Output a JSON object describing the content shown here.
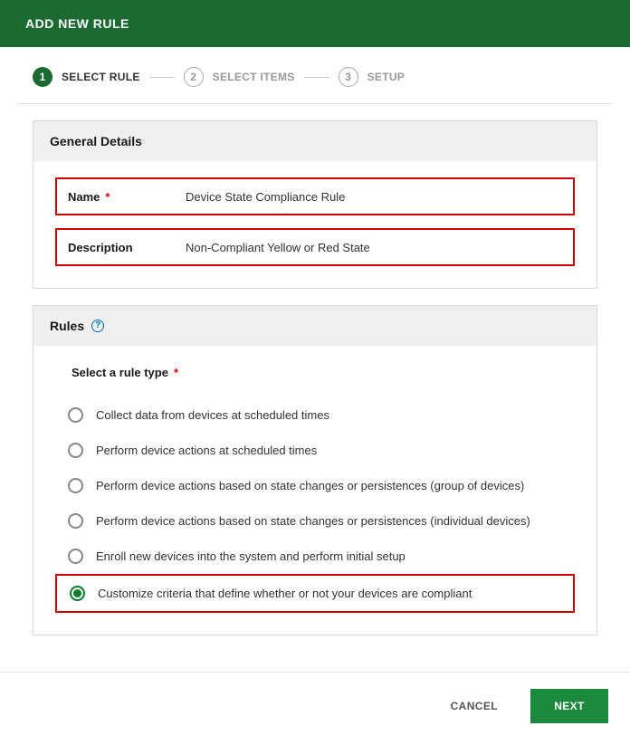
{
  "header": {
    "title": "ADD NEW RULE"
  },
  "stepper": {
    "steps": [
      {
        "num": "1",
        "label": "SELECT RULE",
        "active": true
      },
      {
        "num": "2",
        "label": "SELECT ITEMS",
        "active": false
      },
      {
        "num": "3",
        "label": "SETUP",
        "active": false
      }
    ]
  },
  "general": {
    "title": "General Details",
    "name_label": "Name",
    "name_value": "Device State Compliance Rule",
    "desc_label": "Description",
    "desc_value": "Non-Compliant Yellow or Red State"
  },
  "rules": {
    "title": "Rules",
    "section_title": "Select a rule type",
    "options": [
      {
        "label": "Collect data from devices at scheduled times",
        "selected": false,
        "highlighted": false
      },
      {
        "label": "Perform device actions at scheduled times",
        "selected": false,
        "highlighted": false
      },
      {
        "label": "Perform device actions based on state changes or persistences (group of devices)",
        "selected": false,
        "highlighted": false
      },
      {
        "label": "Perform device actions based on state changes or persistences (individual devices)",
        "selected": false,
        "highlighted": false
      },
      {
        "label": "Enroll new devices into the system and perform initial setup",
        "selected": false,
        "highlighted": false
      },
      {
        "label": "Customize criteria that define whether or not your devices are compliant",
        "selected": true,
        "highlighted": true
      }
    ]
  },
  "footer": {
    "cancel": "CANCEL",
    "next": "NEXT"
  }
}
